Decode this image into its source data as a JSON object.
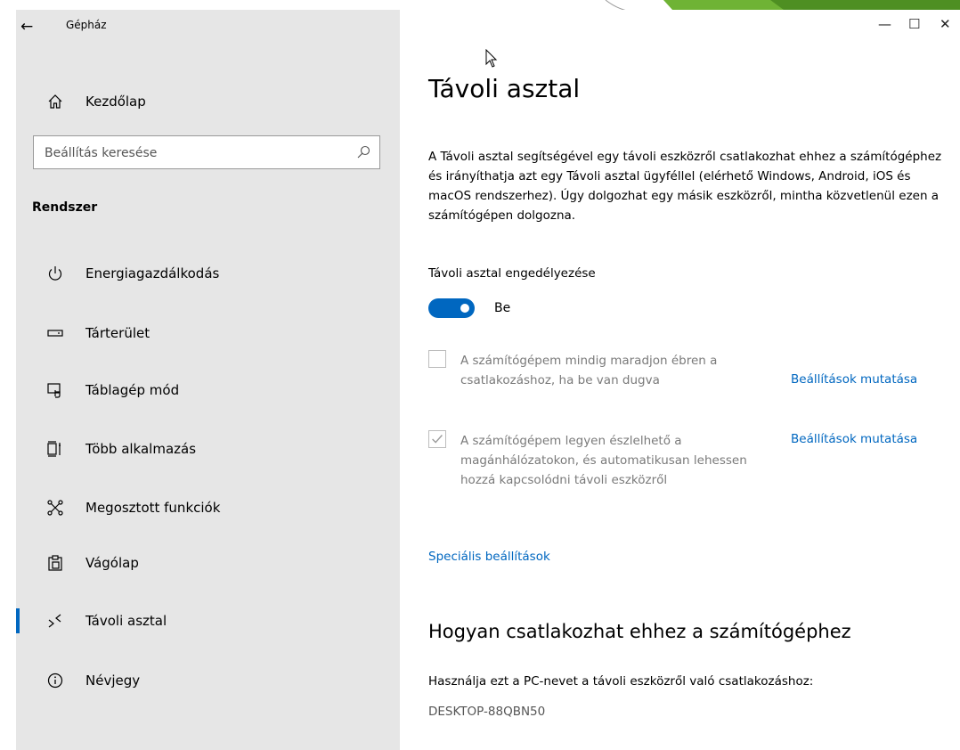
{
  "window": {
    "app_title": "Gépház",
    "controls": {
      "minimize": "—",
      "maximize": "☐",
      "close": "✕"
    }
  },
  "sidebar": {
    "home_label": "Kezdőlap",
    "search_placeholder": "Beállítás keresése",
    "section_title": "Rendszer",
    "items": [
      {
        "label": "Energiagazdálkodás",
        "icon": "power-icon"
      },
      {
        "label": "Tárterület",
        "icon": "storage-icon"
      },
      {
        "label": "Táblagép mód",
        "icon": "tablet-mode-icon"
      },
      {
        "label": "Több alkalmazás",
        "icon": "multitasking-icon"
      },
      {
        "label": "Megosztott funkciók",
        "icon": "shared-experiences-icon"
      },
      {
        "label": "Vágólap",
        "icon": "clipboard-icon"
      },
      {
        "label": "Távoli asztal",
        "icon": "remote-desktop-icon",
        "active": true
      },
      {
        "label": "Névjegy",
        "icon": "info-icon"
      }
    ]
  },
  "main": {
    "title": "Távoli asztal",
    "description": "A Távoli asztal segítségével egy távoli eszközről csatlakozhat ehhez a számítógéphez és irányíthatja azt egy Távoli asztal ügyféllel (elérhető Windows, Android, iOS és macOS rendszerhez). Úgy dolgozhat egy másik eszközről, mintha közvetlenül ezen a számítógépen dolgozna.",
    "enable_label": "Távoli asztal engedélyezése",
    "toggle_state": "Be",
    "toggle_on": true,
    "option1": {
      "text": "A számítógépem mindig maradjon ébren a csatlakozáshoz, ha be van dugva",
      "checked": false,
      "link": "Beállítások mutatása"
    },
    "option2": {
      "text": "A számítógépem legyen észlelhető a magánhálózatokon, és automatikusan lehessen hozzá kapcsolódni távoli eszközről",
      "checked": true,
      "link": "Beállítások mutatása"
    },
    "advanced_link": "Speciális beállítások",
    "how_title": "Hogyan csatlakozhat ehhez a számítógéphez",
    "pc_desc": "Használja ezt a PC-nevet a távoli eszközről való csatlakozáshoz:",
    "pc_name": "DESKTOP-88QBN50"
  },
  "colors": {
    "accent": "#0067c0",
    "sidebar_bg": "#e6e6e6",
    "deco_green": "#6fb335"
  }
}
